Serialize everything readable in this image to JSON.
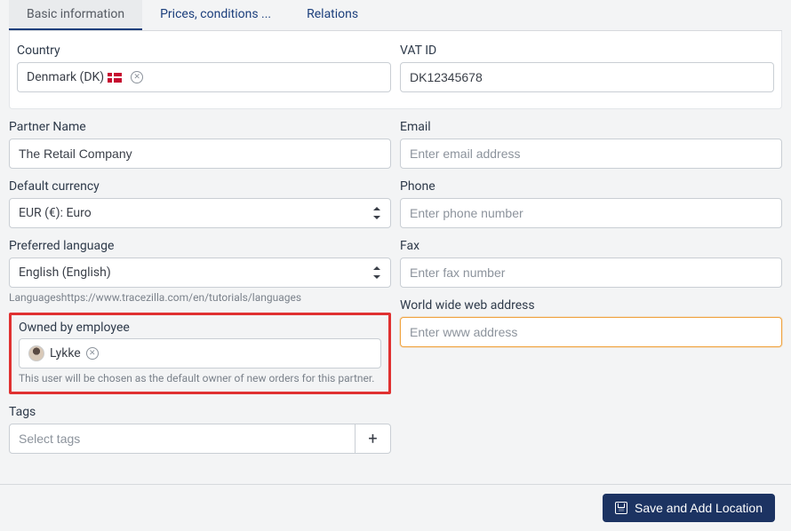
{
  "tabs": {
    "basic": "Basic information",
    "prices": "Prices, conditions ...",
    "relations": "Relations"
  },
  "country": {
    "label": "Country",
    "value": "Denmark (DK)"
  },
  "vat": {
    "label": "VAT ID",
    "value": "DK12345678"
  },
  "partner": {
    "label": "Partner Name",
    "value": "The Retail Company"
  },
  "email": {
    "label": "Email",
    "placeholder": "Enter email address"
  },
  "currency": {
    "label": "Default currency",
    "value": "EUR (€): Euro"
  },
  "phone": {
    "label": "Phone",
    "placeholder": "Enter phone number"
  },
  "language": {
    "label": "Preferred language",
    "value": "English (English)",
    "hint": "Languageshttps://www.tracezilla.com/en/tutorials/languages"
  },
  "fax": {
    "label": "Fax",
    "placeholder": "Enter fax number"
  },
  "owner": {
    "label": "Owned by employee",
    "value": "Lykke",
    "hint": "This user will be chosen as the default owner of new orders for this partner."
  },
  "www": {
    "label": "World wide web address",
    "placeholder": "Enter www address"
  },
  "tags": {
    "label": "Tags",
    "placeholder": "Select tags"
  },
  "saveButton": "Save and Add Location"
}
